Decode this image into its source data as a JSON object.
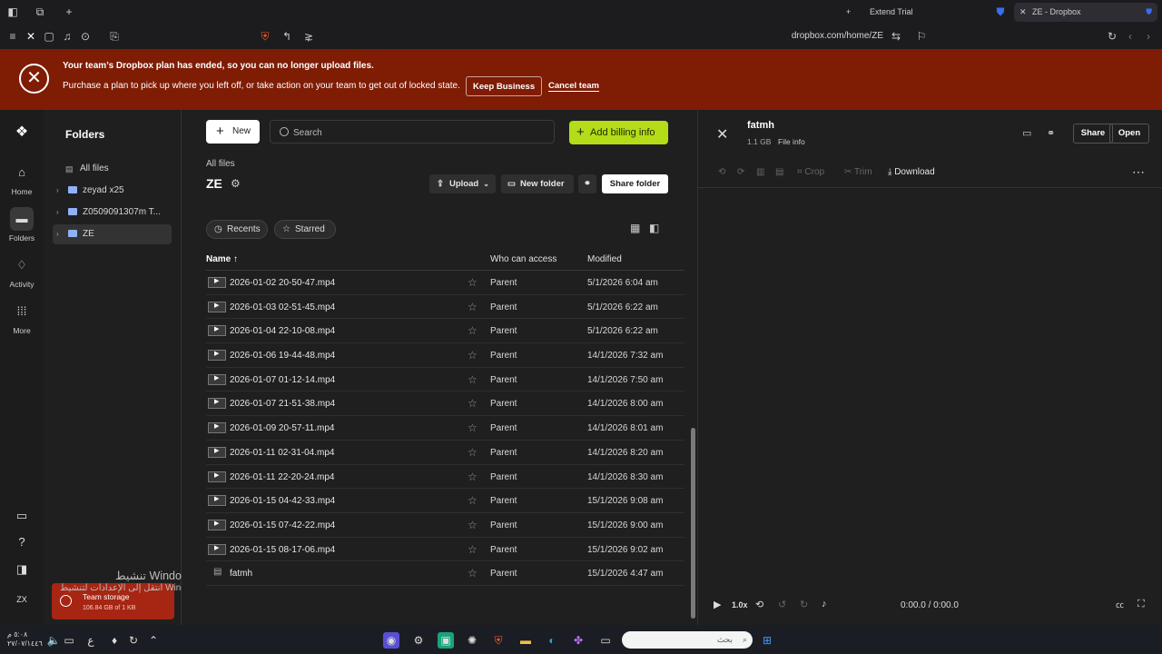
{
  "browser": {
    "tab_trial_label": "Extend Trial",
    "tab_active_title": "ZE - Dropbox",
    "url": "dropbox.com/home/ZE"
  },
  "banner": {
    "title": "Your team’s Dropbox plan has ended, so you can no longer upload files.",
    "description": "Purchase a plan to pick up where you left off, or take action on your team to get out of locked state.",
    "keep_business": "Keep Business",
    "cancel_team": "Cancel team"
  },
  "rail": {
    "home": "Home",
    "folders": "Folders",
    "activity": "Activity",
    "more": "More",
    "avatar": "ZX"
  },
  "sidebar": {
    "title": "Folders",
    "all_files": "All files",
    "items": [
      {
        "label": "zeyad x25"
      },
      {
        "label": "Z0509091307m T..."
      },
      {
        "label": "ZE"
      }
    ]
  },
  "storage": {
    "title": "Team storage",
    "usage": "106.84 GB of 1 KB"
  },
  "watermark": {
    "line1": "تنشيط Windows",
    "line2": "انتقل إلى الإعدادات لتنشيط Windows"
  },
  "main": {
    "new_label": "New",
    "search_placeholder": "Search",
    "billing_label": "Add billing info",
    "breadcrumb": "All files",
    "folder_title": "ZE",
    "upload_label": "Upload",
    "new_folder_label": "New folder",
    "share_folder_label": "Share folder",
    "recents_label": "Recents",
    "starred_label": "Starred",
    "columns": {
      "name": "Name",
      "access": "Who can access",
      "modified": "Modified"
    },
    "files": [
      {
        "name": "2026-01-02 20-50-47.mp4",
        "access": "Parent",
        "modified": "5/1/2026 6:04 am"
      },
      {
        "name": "2026-01-03 02-51-45.mp4",
        "access": "Parent",
        "modified": "5/1/2026 6:22 am"
      },
      {
        "name": "2026-01-04 22-10-08.mp4",
        "access": "Parent",
        "modified": "5/1/2026 6:22 am"
      },
      {
        "name": "2026-01-06 19-44-48.mp4",
        "access": "Parent",
        "modified": "14/1/2026 7:32 am"
      },
      {
        "name": "2026-01-07 01-12-14.mp4",
        "access": "Parent",
        "modified": "14/1/2026 7:50 am"
      },
      {
        "name": "2026-01-07 21-51-38.mp4",
        "access": "Parent",
        "modified": "14/1/2026 8:00 am"
      },
      {
        "name": "2026-01-09 20-57-11.mp4",
        "access": "Parent",
        "modified": "14/1/2026 8:01 am"
      },
      {
        "name": "2026-01-11 02-31-04.mp4",
        "access": "Parent",
        "modified": "14/1/2026 8:20 am"
      },
      {
        "name": "2026-01-11 22-20-24.mp4",
        "access": "Parent",
        "modified": "14/1/2026 8:30 am"
      },
      {
        "name": "2026-01-15 04-42-33.mp4",
        "access": "Parent",
        "modified": "15/1/2026 9:08 am"
      },
      {
        "name": "2026-01-15 07-42-22.mp4",
        "access": "Parent",
        "modified": "15/1/2026 9:00 am"
      },
      {
        "name": "2026-01-15 08-17-06.mp4",
        "access": "Parent",
        "modified": "15/1/2026 9:02 am"
      },
      {
        "name": "fatmh",
        "access": "Parent",
        "modified": "15/1/2026 4:47 am"
      }
    ]
  },
  "preview": {
    "file_name": "fatmh",
    "file_size": "1.1 GB",
    "file_info": "File info",
    "share_label": "Share",
    "open_label": "Open",
    "crop_label": "Crop",
    "trim_label": "Trim",
    "download_label": "Download",
    "speed": "1.0x",
    "time": "0:00.0 / 0:00.0"
  },
  "taskbar": {
    "search_placeholder": "بحث",
    "clock_time": "٥:٠٨ م",
    "clock_date": "٢٧/٠٧/١٤٤٦",
    "lang": "ع"
  },
  "colors": {
    "banner": "#7e1c04",
    "billing": "#b4dc19",
    "storage": "#a72513",
    "folder_icon": "#8fb1f7"
  }
}
